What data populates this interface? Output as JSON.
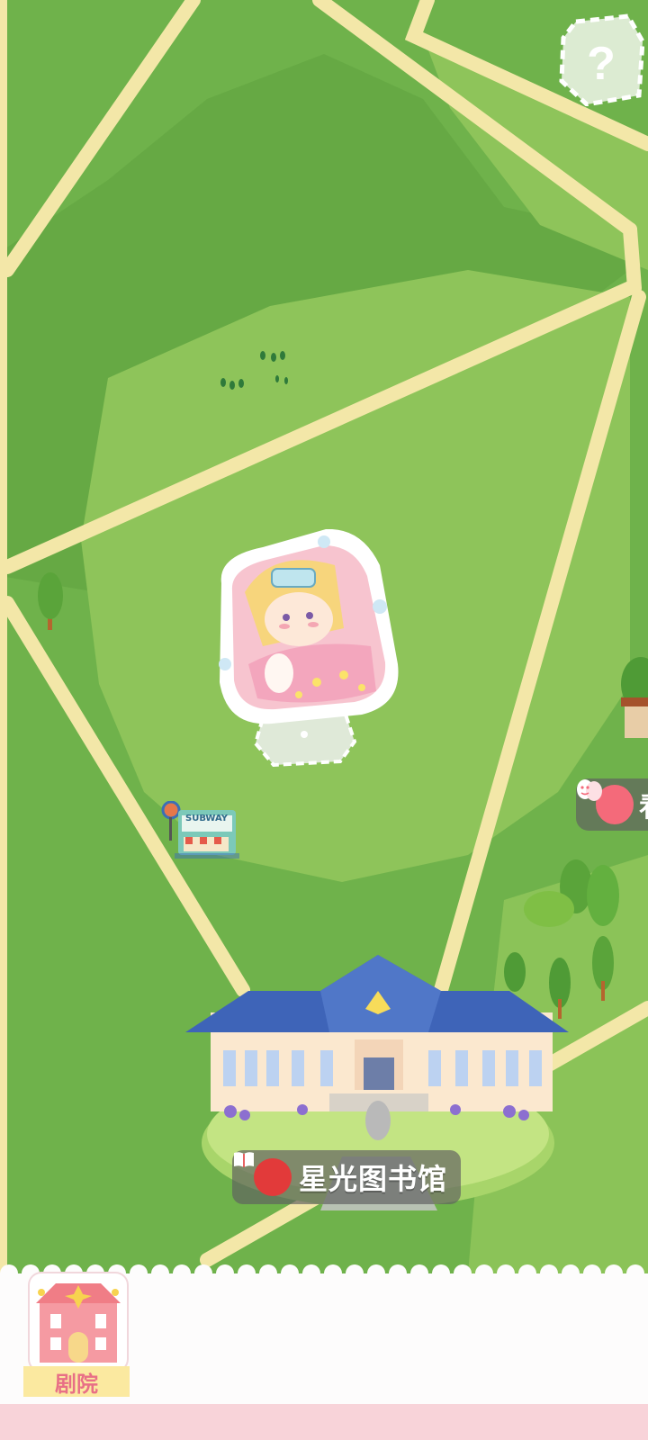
{
  "map": {
    "help_icon": "question-mark-icon",
    "character": "sleeping-girl-sticker",
    "subway_sign": "SUBWAY",
    "library_label": "星光图书馆",
    "library_icon": "book-icon",
    "right_label_partial": "看",
    "right_label_icon": "theater-masks-icon"
  },
  "bottom_bar": {
    "theater_label": "剧院",
    "theater_icon": "theater-building-icon"
  },
  "colors": {
    "grass_dark": "#6fb24b",
    "grass_light": "#8ec45a",
    "road": "#f3e7a8",
    "accent_pink": "#f8d3d9",
    "library_roof": "#3e64b8"
  }
}
